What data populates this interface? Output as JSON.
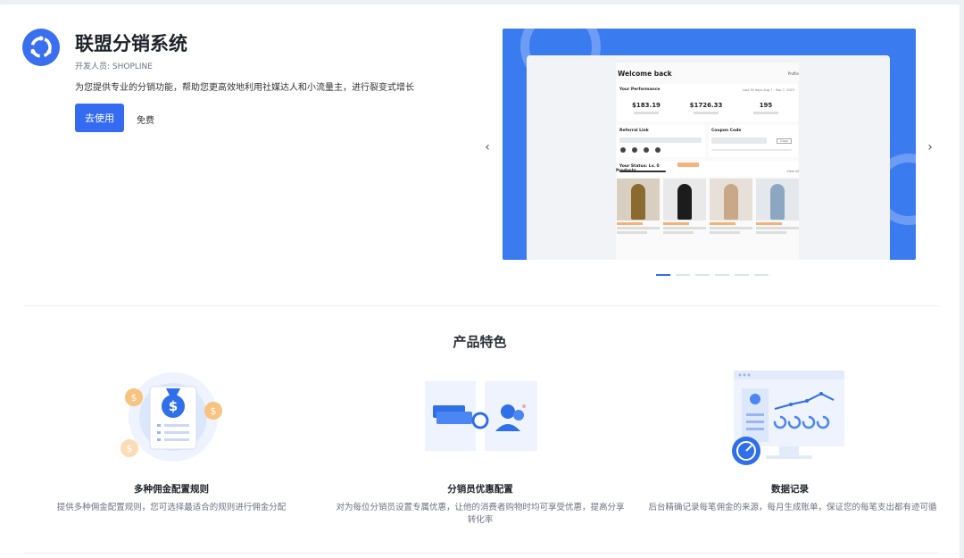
{
  "app": {
    "title": "联盟分销系统",
    "developer": "开发人员: SHOPLINE",
    "description": "为您提供专业的分销功能，帮助您更高效地利用社媒达人和小流量主，进行裂变式增长",
    "use_button": "去使用",
    "price": "免费",
    "logo_icon": "affiliate-logo-icon",
    "accent_color": "#356bf0"
  },
  "carousel": {
    "prev_icon": "‹",
    "next_icon": "›",
    "slide_count": 6,
    "active_index": 0,
    "slide": {
      "welcome": "Welcome back",
      "profile": "Profile",
      "performance_title": "Your Performance",
      "date_range": "Last 30 days   Aug 7 - Sep 7, 2023",
      "stats": [
        "$183.19",
        "$1726.33",
        "195"
      ],
      "referral_title": "Referral Link",
      "coupon_title": "Coupon Code",
      "copy": "Copy",
      "status_title": "Your Status: Lv. 0",
      "products_title": "Products",
      "view_all": "View all"
    }
  },
  "features": {
    "section_title": "产品特色",
    "items": [
      {
        "title": "多种佣金配置规则",
        "desc": "提供多种佣金配置规则，您可选择最适合的规则进行佣金分配",
        "icon": "money-bag-icon"
      },
      {
        "title": "分销员优惠配置",
        "desc": "对为每位分销员设置专属优惠，让他的消费者购物时均可享受优惠，提高分享转化率",
        "icon": "coupon-users-icon"
      },
      {
        "title": "数据记录",
        "desc": "后台精确记录每笔佣金的来源，每月生成账单，保证您的每笔支出都有迹可循",
        "icon": "data-chart-icon"
      }
    ]
  }
}
